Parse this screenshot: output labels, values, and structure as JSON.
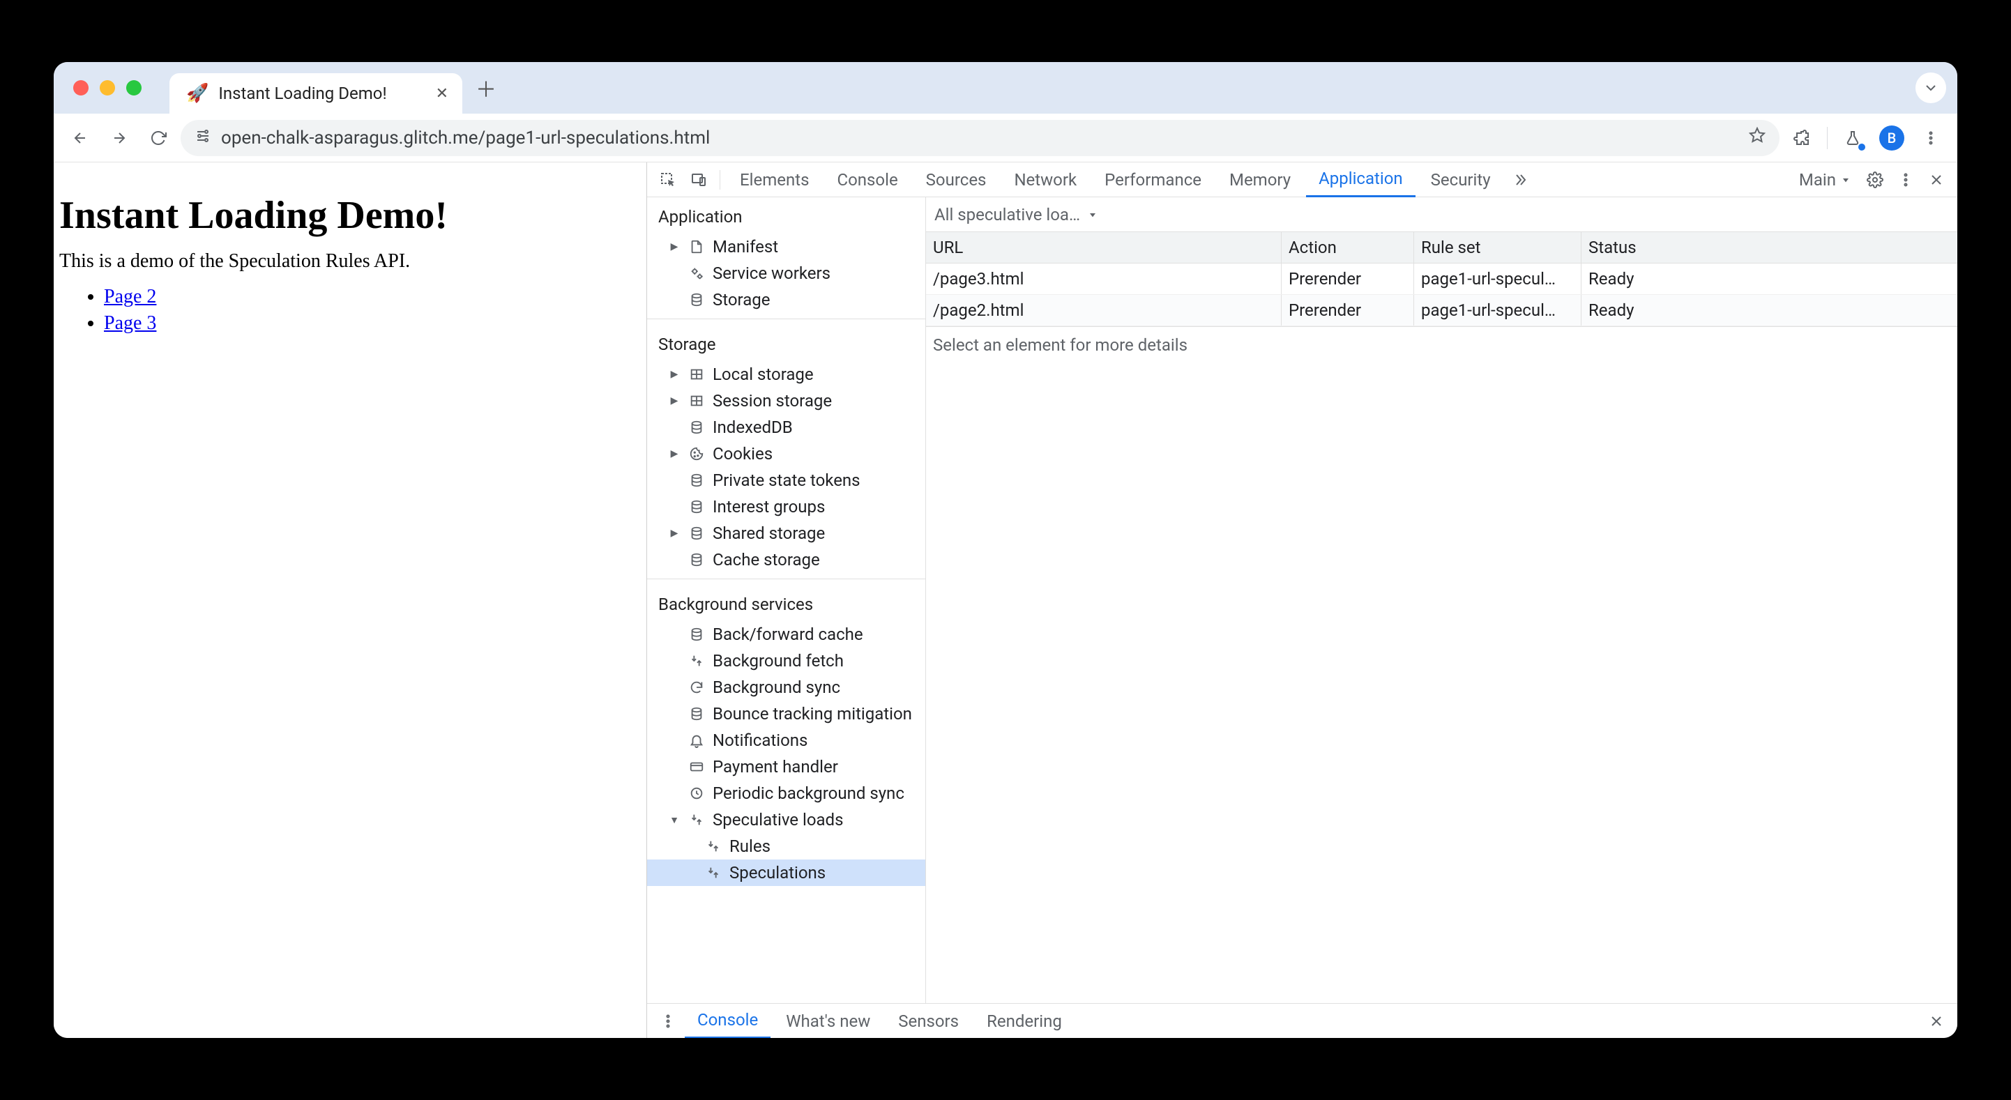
{
  "browser": {
    "tab": {
      "favicon": "🚀",
      "title": "Instant Loading Demo!"
    },
    "url": "open-chalk-asparagus.glitch.me/page1-url-speculations.html",
    "avatar_letter": "B"
  },
  "page": {
    "heading": "Instant Loading Demo!",
    "paragraph": "This is a demo of the Speculation Rules API.",
    "links": [
      "Page 2",
      "Page 3"
    ]
  },
  "devtools": {
    "tabs": [
      "Elements",
      "Console",
      "Sources",
      "Network",
      "Performance",
      "Memory",
      "Application",
      "Security"
    ],
    "active_tab": "Application",
    "target_label": "Main",
    "sidebar": {
      "sections": [
        {
          "title": "Application",
          "items": [
            {
              "label": "Manifest",
              "icon": "file",
              "expandable": true
            },
            {
              "label": "Service workers",
              "icon": "gears"
            },
            {
              "label": "Storage",
              "icon": "db"
            }
          ]
        },
        {
          "title": "Storage",
          "items": [
            {
              "label": "Local storage",
              "icon": "grid",
              "expandable": true
            },
            {
              "label": "Session storage",
              "icon": "grid",
              "expandable": true
            },
            {
              "label": "IndexedDB",
              "icon": "db"
            },
            {
              "label": "Cookies",
              "icon": "cookie",
              "expandable": true
            },
            {
              "label": "Private state tokens",
              "icon": "db"
            },
            {
              "label": "Interest groups",
              "icon": "db"
            },
            {
              "label": "Shared storage",
              "icon": "db",
              "expandable": true
            },
            {
              "label": "Cache storage",
              "icon": "db"
            }
          ]
        },
        {
          "title": "Background services",
          "items": [
            {
              "label": "Back/forward cache",
              "icon": "db"
            },
            {
              "label": "Background fetch",
              "icon": "arrows"
            },
            {
              "label": "Background sync",
              "icon": "sync"
            },
            {
              "label": "Bounce tracking mitigation",
              "icon": "db"
            },
            {
              "label": "Notifications",
              "icon": "bell"
            },
            {
              "label": "Payment handler",
              "icon": "card"
            },
            {
              "label": "Periodic background sync",
              "icon": "clock"
            },
            {
              "label": "Speculative loads",
              "icon": "arrows",
              "expandable": true,
              "expanded": true,
              "children": [
                {
                  "label": "Rules",
                  "icon": "arrows"
                },
                {
                  "label": "Speculations",
                  "icon": "arrows",
                  "selected": true
                }
              ]
            }
          ]
        }
      ]
    },
    "main": {
      "filter_label": "All speculative loa…",
      "columns": [
        "URL",
        "Action",
        "Rule set",
        "Status"
      ],
      "rows": [
        {
          "url": "/page3.html",
          "action": "Prerender",
          "ruleset": "page1-url-specul…",
          "status": "Ready"
        },
        {
          "url": "/page2.html",
          "action": "Prerender",
          "ruleset": "page1-url-specul…",
          "status": "Ready"
        }
      ],
      "details_placeholder": "Select an element for more details"
    },
    "drawer": {
      "tabs": [
        "Console",
        "What's new",
        "Sensors",
        "Rendering"
      ],
      "active": "Console"
    }
  }
}
